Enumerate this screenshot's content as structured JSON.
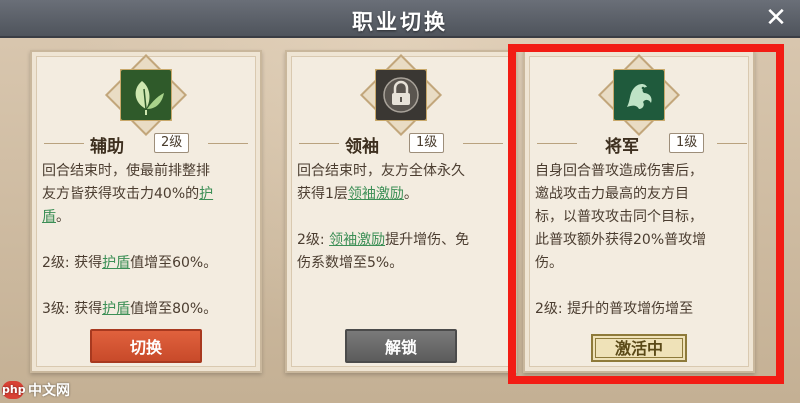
{
  "header": {
    "title": "职业切换",
    "close_glyph": "✕"
  },
  "cards": [
    {
      "name": "辅助",
      "level": "2级",
      "icon": "leaf-icon",
      "desc_lines": [
        "回合结束时，使最前排整排",
        "友方皆获得攻击力40%的护",
        "盾。",
        "",
        "2级: 获得护盾值增至60%。",
        "",
        "3级: 获得护盾值增至80%。"
      ],
      "highlight_word": "护盾",
      "button_label": "切换",
      "button_color": "#d4553a"
    },
    {
      "name": "领袖",
      "level": "1级",
      "icon": "lock-icon",
      "desc_lines": [
        "回合结束时，友方全体永久",
        "获得1层领袖激励。",
        "",
        "2级: 领袖激励提升增伤、免",
        "伤系数增至5%。"
      ],
      "highlight_word": "领袖激励",
      "button_label": "解锁",
      "button_color": "#6b6b6b"
    },
    {
      "name": "将军",
      "level": "1级",
      "icon": "dragon-icon",
      "desc_lines": [
        "自身回合普攻造成伤害后，",
        "邀战攻击力最高的友方目",
        "标，以普攻攻击同个目标，",
        "此普攻额外获得20%普攻增",
        "伤。",
        "",
        "2级: 提升的普攻增伤增至"
      ],
      "status_label": "激活中"
    }
  ],
  "watermark": {
    "logo": "php",
    "text": "中文网"
  },
  "colors": {
    "highlight_frame": "#f21c14",
    "accent_green": "#3c8f56"
  }
}
